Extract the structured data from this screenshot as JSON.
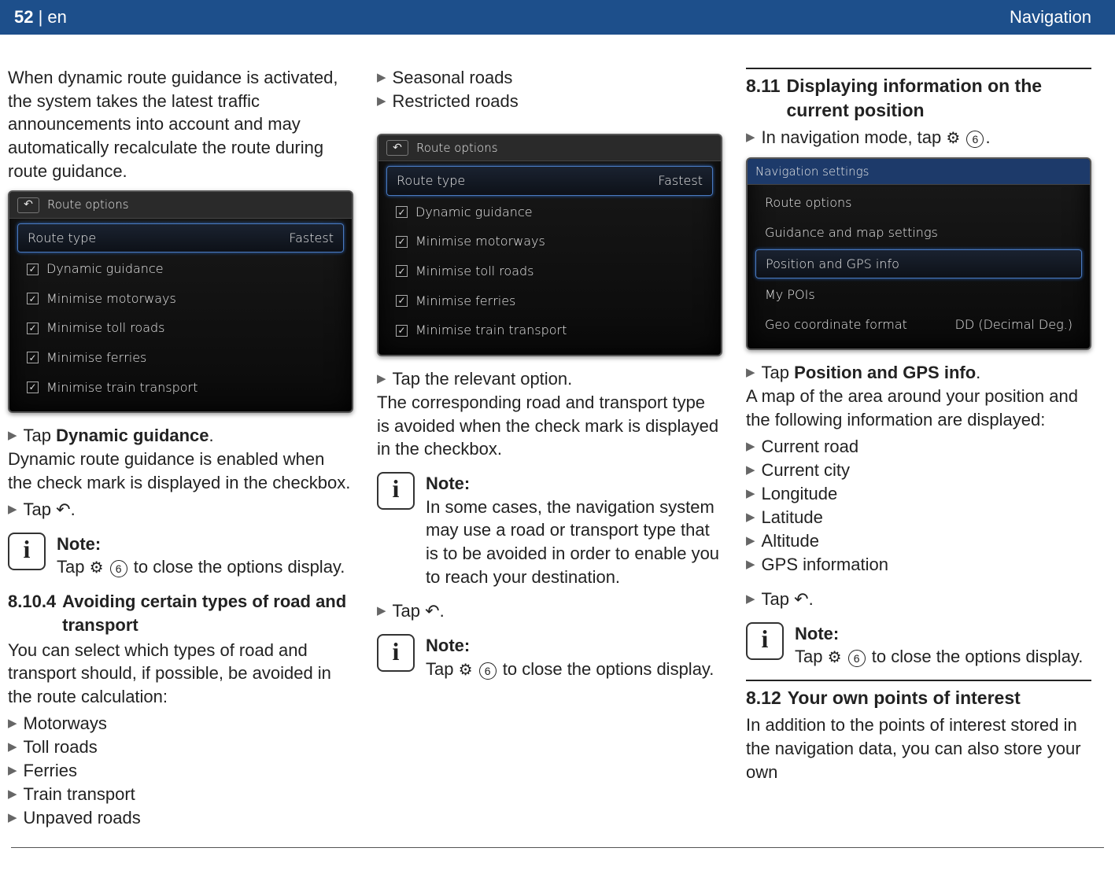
{
  "header": {
    "page_no": "52",
    "lang_sep": " | en",
    "section": "Navigation"
  },
  "col1": {
    "intro": "When dynamic route guidance is activated, the system takes the latest traffic announcements into account and may automatically recalculate the route during route guidance.",
    "dev1": {
      "title": "Route options",
      "row_type_label": "Route type",
      "row_type_value": "Fastest",
      "opts": [
        "Dynamic guidance",
        "Minimise motorways",
        "Minimise toll roads",
        "Minimise ferries",
        "Minimise train transport"
      ]
    },
    "step1_pre": "Tap ",
    "step1_bold": "Dynamic guidance",
    "step1_post": ".",
    "after1": "Dynamic route guidance is enabled when the check mark is displayed in the checkbox.",
    "step2": "Tap ",
    "note": {
      "title": "Note:",
      "pre": "Tap ",
      "post": " to close the options display.",
      "num": "6"
    },
    "sub_num": "8.10.4",
    "sub_title": "Avoiding certain types of road and transport",
    "sub_body": "You can select which types of road and transport should, if possible, be avoided in the route calculation:",
    "avoid_list": [
      "Motorways",
      "Toll roads",
      "Ferries",
      "Train transport",
      "Unpaved roads"
    ]
  },
  "col2": {
    "top_list": [
      "Seasonal roads",
      "Restricted roads"
    ],
    "dev2": {
      "title": "Route options",
      "row_type_label": "Route type",
      "row_type_value": "Fastest",
      "opts": [
        "Dynamic guidance",
        "Minimise motorways",
        "Minimise toll roads",
        "Minimise ferries",
        "Minimise train transport"
      ]
    },
    "step1": "Tap the relevant option.",
    "body1": "The corresponding road and transport type is avoided when the check mark is displayed in the checkbox.",
    "note1": {
      "title": "Note:",
      "body": "In some cases, the navigation system may use a road or transport type that is to be avoided in order to enable you to reach your destination."
    },
    "step2": "Tap ",
    "note2": {
      "title": "Note:",
      "pre": "Tap ",
      "post": " to close the options display.",
      "num": "6"
    }
  },
  "col3": {
    "sec_num": "8.11",
    "sec_title": "Displaying information on the current position",
    "step1_pre": "In navigation mode, tap ",
    "step1_num": "6",
    "dev3": {
      "title": "Navigation settings",
      "rows": [
        "Route options",
        "Guidance and map settings",
        "Position and GPS info",
        "My POIs"
      ],
      "geo_label": "Geo coordinate format",
      "geo_value": "DD (Decimal Deg.)"
    },
    "step2_pre": "Tap ",
    "step2_bold": "Position and GPS info",
    "step2_post": ".",
    "body1": "A map of the area around your position and the following information are displayed:",
    "info_list": [
      "Current road",
      "Current city",
      "Longitude",
      "Latitude",
      "Altitude",
      "GPS information"
    ],
    "step3": "Tap ",
    "note": {
      "title": "Note:",
      "pre": "Tap ",
      "post": " to close the options display.",
      "num": "6"
    },
    "sec2_num": "8.12",
    "sec2_title": "Your own points of interest",
    "sec2_body": "In addition to the points of interest stored in the navigation data, you can also store your own"
  }
}
